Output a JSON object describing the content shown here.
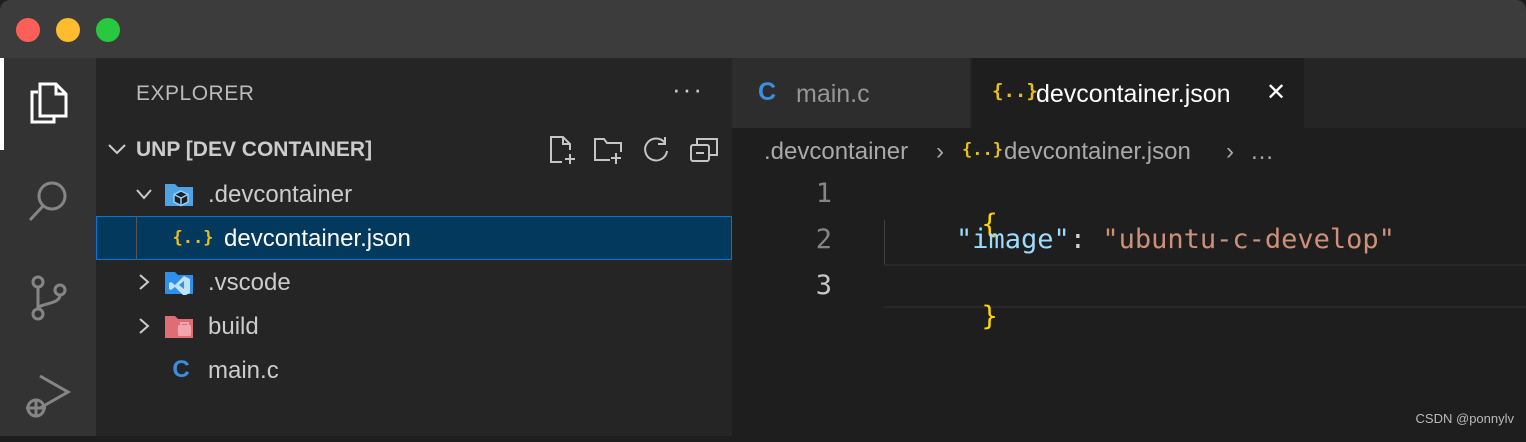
{
  "window": {
    "controls": [
      "close",
      "minimize",
      "zoom"
    ]
  },
  "activity_bar": {
    "items": [
      {
        "icon": "explorer-icon",
        "active": true
      },
      {
        "icon": "search-icon",
        "active": false
      },
      {
        "icon": "source-control-icon",
        "active": false
      },
      {
        "icon": "run-debug-icon",
        "active": false
      }
    ]
  },
  "sidebar": {
    "title": "EXPLORER",
    "more": "···",
    "section_title": "UNP [DEV CONTAINER]",
    "actions": [
      "new-file-icon",
      "new-folder-icon",
      "refresh-icon",
      "collapse-all-icon"
    ],
    "tree": [
      {
        "label": ".devcontainer",
        "type": "folder",
        "expanded": true,
        "icon": "devcontainer-folder-icon",
        "icon_color": "#4fa3e3"
      },
      {
        "label": "devcontainer.json",
        "type": "file",
        "selected": true,
        "icon": "json-icon",
        "icon_glyph": "{..}",
        "icon_color": "#e8c01d"
      },
      {
        "label": ".vscode",
        "type": "folder",
        "expanded": false,
        "icon": "vscode-folder-icon",
        "icon_color": "#2e90e8"
      },
      {
        "label": "build",
        "type": "folder",
        "expanded": false,
        "icon": "build-folder-icon",
        "icon_color": "#e06c75"
      },
      {
        "label": "main.c",
        "type": "file",
        "icon": "c-file-icon",
        "icon_glyph": "C",
        "icon_color": "#3c8ee0"
      }
    ]
  },
  "tabs": [
    {
      "label": "main.c",
      "icon_glyph": "C",
      "icon_color": "#3c8ee0",
      "active": false
    },
    {
      "label": "devcontainer.json",
      "icon_glyph": "{..}",
      "icon_color": "#e8c01d",
      "active": true,
      "close": "✕"
    }
  ],
  "breadcrumbs": {
    "folder": ".devcontainer",
    "sep": "›",
    "file_icon": "{..}",
    "file": "devcontainer.json",
    "more": "…"
  },
  "editor": {
    "line_numbers": [
      "1",
      "2",
      "3"
    ],
    "current_line": "3",
    "lines": [
      {
        "open_brace": "{"
      },
      {
        "key": "\"image\"",
        "colon": ": ",
        "value": "\"ubuntu-c-develop\""
      },
      {
        "close_brace": "}"
      }
    ],
    "colors": {
      "brace": "#ffd700",
      "key": "#9cdcfe",
      "string": "#ce9178"
    }
  },
  "watermark": "CSDN @ponnylv"
}
